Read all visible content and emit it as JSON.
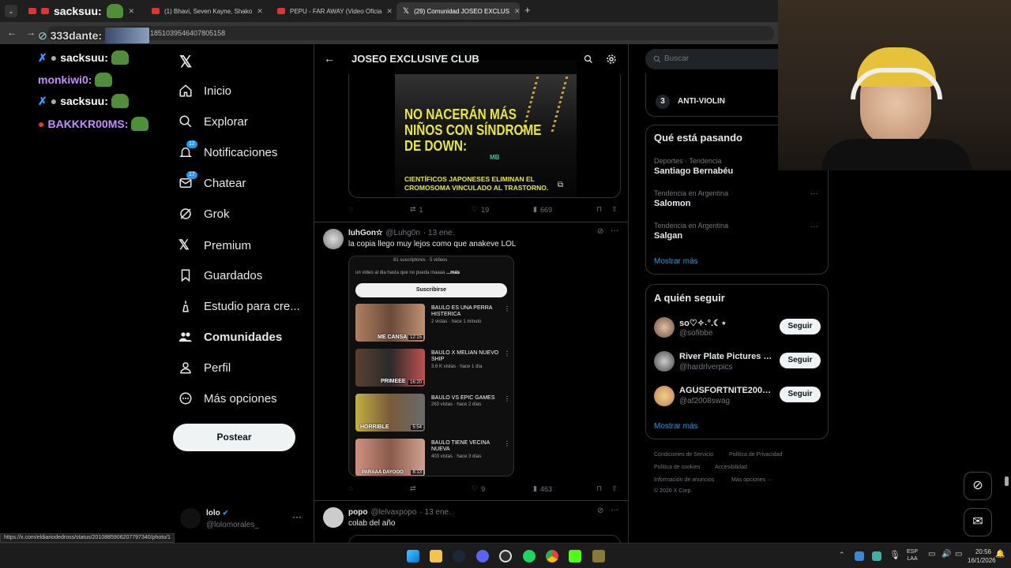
{
  "browser": {
    "tabs": [
      {
        "label": "sacksuu:",
        "type": "youtube"
      },
      {
        "label": "(1) Bhavi, Seven Kayne, Shako",
        "type": "youtube"
      },
      {
        "label": "PEPU - FAR AWAY (Video Oficia",
        "type": "youtube"
      },
      {
        "label": "(29) Comunidad JOSEO EXCLUS",
        "type": "x"
      }
    ],
    "url": "1851039546407805158",
    "status_url": "https://x.com/eldiariodedross/status/2010885906207797340/photo/1"
  },
  "stream_chat": [
    {
      "user": "333dante:",
      "color": "#d8d8d8"
    },
    {
      "user": "sacksuu:",
      "color": "#ffffff"
    },
    {
      "user": "monkiwi0:",
      "color": "#c48cff"
    },
    {
      "user": "sacksuu:",
      "color": "#ffffff"
    },
    {
      "user": "BAKKKR00MS:",
      "color": "#c48cff"
    }
  ],
  "sidebar": {
    "items": [
      {
        "label": "Inicio",
        "icon": "home-icon"
      },
      {
        "label": "Explorar",
        "icon": "search-icon"
      },
      {
        "label": "Notificaciones",
        "icon": "bell-icon",
        "badge": "12"
      },
      {
        "label": "Chatear",
        "icon": "mail-icon",
        "badge": "17"
      },
      {
        "label": "Grok",
        "icon": "grok-icon"
      },
      {
        "label": "Premium",
        "icon": "x-icon"
      },
      {
        "label": "Guardados",
        "icon": "bookmark-icon"
      },
      {
        "label": "Estudio para cre...",
        "icon": "studio-icon"
      },
      {
        "label": "Comunidades",
        "icon": "people-icon"
      },
      {
        "label": "Perfil",
        "icon": "person-icon"
      },
      {
        "label": "Más opciones",
        "icon": "more-icon"
      }
    ],
    "post_label": "Postear",
    "account": {
      "name": "lolo",
      "handle": "@lolomorales_"
    }
  },
  "timeline": {
    "title": "JOSEO EXCLUSIVE CLUB",
    "post1": {
      "headline": "NO NACERÁN MÁS NIÑOS CON SÍNDROME DE DOWN:",
      "sub": "CIENTÍFICOS JAPONESES ELIMINAN EL CROMOSOMA VINCULADO AL TRASTORNO.",
      "logo": "MB",
      "retweets": "1",
      "likes": "19",
      "views": "669"
    },
    "post2": {
      "name": "luhGon✫",
      "handle": "@Luhg0n",
      "date": "· 13 ene.",
      "text": "la copia llego muy lejos como que anakeve LOL",
      "yt_header": "81 suscriptores · 5 videos",
      "yt_desc": "un video al dia hasta que no pueda maaaa",
      "yt_desc_more": "...más",
      "yt_subscribe": "Suscribirse",
      "videos": [
        {
          "title": "BAULO ES UNA PERRA HISTERICA",
          "meta": "2 vistas · hace 1 minuto",
          "duration": "12:15",
          "caption": "ME CANSA"
        },
        {
          "title": "BAULO X MELIAN NUEVO SHIP",
          "meta": "3.6 K vistas · hace 1 día",
          "duration": "16:20",
          "caption": "PRIMEEE"
        },
        {
          "title": "BAULO VS EPIC GAMES",
          "meta": "263 vistas · hace 2 días",
          "duration": "5:54",
          "caption": "HORRIBLE"
        },
        {
          "title": "BAULO TIENE VECINA NUEVA",
          "meta": "403 vistas · hace 3 días",
          "duration": "8:13",
          "caption": "PARAAA DAYOOO"
        }
      ],
      "likes": "9",
      "views": "463"
    },
    "post3": {
      "name": "popo",
      "handle": "@lelvaxpopo",
      "date": "· 13 ene.",
      "text": "colab del año"
    }
  },
  "right": {
    "search_placeholder": "Buscar",
    "trend_rank": "3",
    "trend_rank_name": "ANTI-VIOLIN",
    "happening_title": "Qué está pasando",
    "trends": [
      {
        "category": "Deportes · Tendencia",
        "name": "Santiago Bernabéu"
      },
      {
        "category": "Tendencia en Argentina",
        "name": "Salomon"
      },
      {
        "category": "Tendencia en Argentina",
        "name": "Salgan"
      }
    ],
    "show_more": "Mostrar más",
    "follow_title": "A quién seguir",
    "follows": [
      {
        "name": "so♡✧˖°.☾⋆",
        "handle": "@sofibbe",
        "button": "Seguir"
      },
      {
        "name": "River Plate Pictures Th...",
        "handle": "@hardrlverpics",
        "button": "Seguir"
      },
      {
        "name": "AGUSFORTNITE2008 ...",
        "handle": "@af2008swag",
        "button": "Seguir"
      }
    ],
    "footer": [
      "Condiciones de Servicio",
      "Política de Privacidad",
      "Política de cookies",
      "Accesibilidad",
      "Información de anuncios",
      "Más opciones ···",
      "© 2026 X Corp."
    ]
  },
  "taskbar": {
    "lang": "ESP",
    "lang2": "LAA",
    "time": "20:56",
    "date": "16/1/2026"
  },
  "colors": {
    "accent": "#1d9bf0",
    "background": "#000000"
  }
}
